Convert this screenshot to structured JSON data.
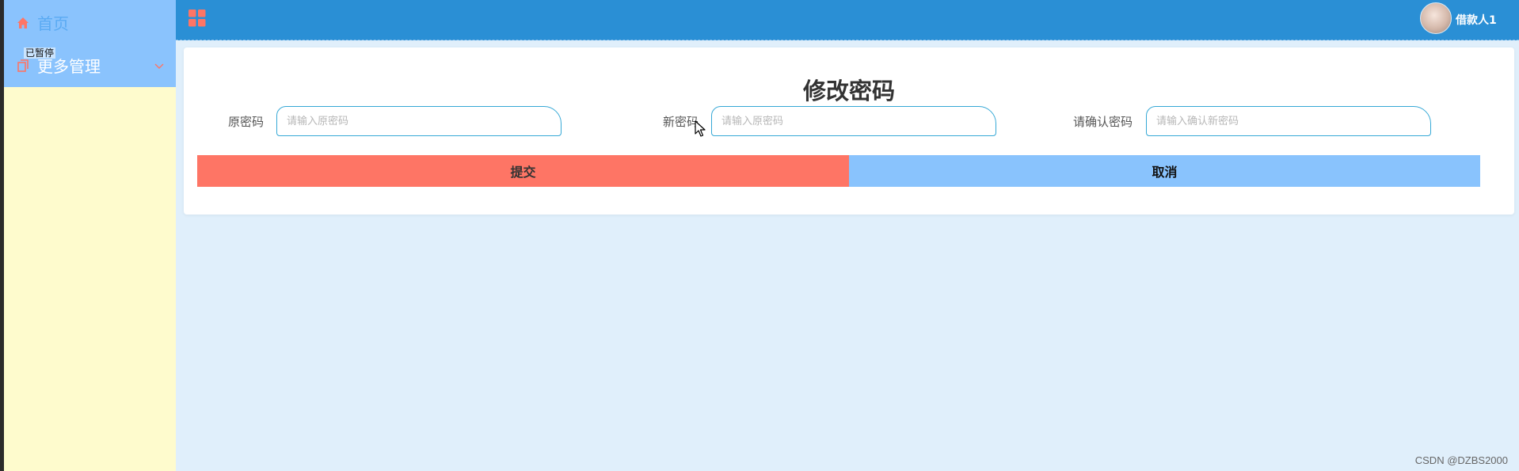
{
  "sidebar": {
    "home_label": "首页",
    "more_label": "更多管理",
    "tooltip": "已暂停",
    "icons": [
      "home-icon",
      "document-icon",
      "chevron-down-icon"
    ]
  },
  "header": {
    "menu_icon": "grid-icon",
    "username": "借款人1"
  },
  "form": {
    "title": "修改密码",
    "fields": [
      {
        "label": "原密码",
        "placeholder": "请输入原密码"
      },
      {
        "label": "新密码",
        "placeholder": "请输入原密码"
      },
      {
        "label": "请确认密码",
        "placeholder": "请输入确认新密码"
      }
    ],
    "submit_label": "提交",
    "cancel_label": "取消"
  },
  "watermark": "CSDN @DZBS2000",
  "colors": {
    "sidebar_top": "#8ac3fd",
    "sidebar_bg": "#fefbcd",
    "header_bg": "#2a8fd5",
    "page_bg": "#e0effb",
    "submit_bg": "#fe7565",
    "cancel_bg": "#89c3fd",
    "icon_accent": "#fe7565",
    "input_border": "#35a8d6"
  }
}
